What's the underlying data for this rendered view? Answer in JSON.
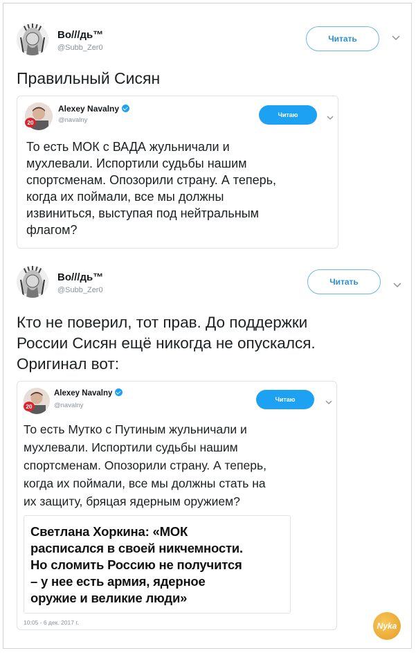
{
  "tweet1": {
    "author_name": "Во///дь™",
    "author_handle": "@Subb_Zer0",
    "follow_label": "Читать",
    "text": "Правильный Сисян",
    "quote": {
      "author_name": "Alexey Navalny",
      "author_handle": "@navalny",
      "follow_label": "Читаю",
      "avatar_badge": "20",
      "lines": [
        "То есть МОК с ВАДА жульничали и",
        "мухлевали. Испортили судьбы нашим",
        "спортсменам. Опозорили страну. А теперь,",
        "когда их поймали, все мы должны",
        "извиниться, выступая под нейтральным",
        "флагом?"
      ]
    }
  },
  "tweet2": {
    "author_name": "Во///дь™",
    "author_handle": "@Subb_Zer0",
    "follow_label": "Читать",
    "lines": [
      "Кто не поверил, тот прав. До поддержки",
      "России Сисян ещё никогда не опускался.",
      "Оригинал вот:"
    ],
    "quote": {
      "author_name": "Alexey Navalny",
      "author_handle": "@navalny",
      "follow_label": "Читаю",
      "avatar_badge": "20",
      "lines": [
        "То есть Мутко с Путиным жульничали и",
        "мухлевали. Испортили судьбы нашим",
        "спортсменам. Опозорили страну. А теперь,",
        "когда их поймали, все мы должны стать на",
        "их защиту, бряцая ядерным оружием?"
      ],
      "headline": [
        "Светлана Хоркина: «МОК",
        "расписался в своей никчемности.",
        "Но сломить Россию не получится",
        "– у нее есть армия, ядерное",
        "оружие и великие люди»"
      ],
      "timestamp": "10:05 - 6 дек. 2017 г."
    }
  },
  "watermark": "Nyka",
  "icons": {
    "chevron": "chevron-down-icon",
    "verified": "verified-badge-icon"
  },
  "colors": {
    "accent": "#1da1f2",
    "outline_text": "#2b8fd6",
    "muted": "#8a9198"
  }
}
